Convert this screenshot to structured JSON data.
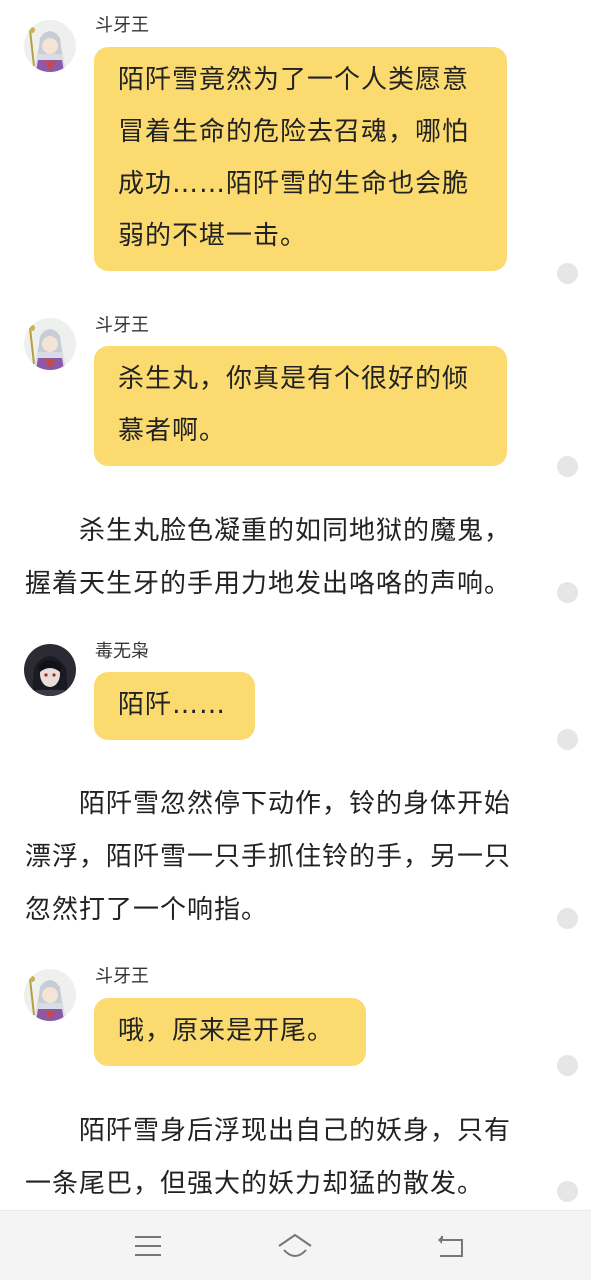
{
  "messages": [
    {
      "speaker": "斗牙王",
      "avatar": "silver-hair-demon-avatar",
      "lines": [
        "陌阡雪竟然为了一个人类愿意",
        "冒着生命的危险去召魂，哪怕",
        "成功……陌阡雪的生命也会脆",
        "弱的不堪一击。"
      ]
    },
    {
      "speaker": "斗牙王",
      "avatar": "silver-hair-demon-avatar",
      "lines": [
        "杀生丸，你真是有个很好的倾",
        "慕者啊。"
      ]
    },
    {
      "speaker": "毒无枭",
      "avatar": "dark-hair-character-avatar",
      "lines": [
        "陌阡……"
      ]
    },
    {
      "speaker": "斗牙王",
      "avatar": "silver-hair-demon-avatar",
      "lines": [
        "哦，原来是开尾。"
      ]
    }
  ],
  "narrations": [
    {
      "lines": [
        "　　杀生丸脸色凝重的如同地狱的魔鬼，",
        "握着天生牙的手用力地发出咯咯的声响。"
      ]
    },
    {
      "lines": [
        "　　陌阡雪忽然停下动作，铃的身体开始",
        "漂浮，陌阡雪一只手抓住铃的手，另一只",
        "忽然打了一个响指。"
      ]
    },
    {
      "lines": [
        "　　陌阡雪身后浮现出自己的妖身，只有",
        "一条尾巴，但强大的妖力却猛的散发。"
      ]
    }
  ],
  "navbar": {
    "menu_icon": "menu-icon",
    "home_icon": "home-icon",
    "back_icon": "back-icon"
  },
  "colors": {
    "bubble": "#fbdb70",
    "text": "#222222",
    "dot": "#e6e6e6",
    "navbar": "#f4f4f4"
  }
}
